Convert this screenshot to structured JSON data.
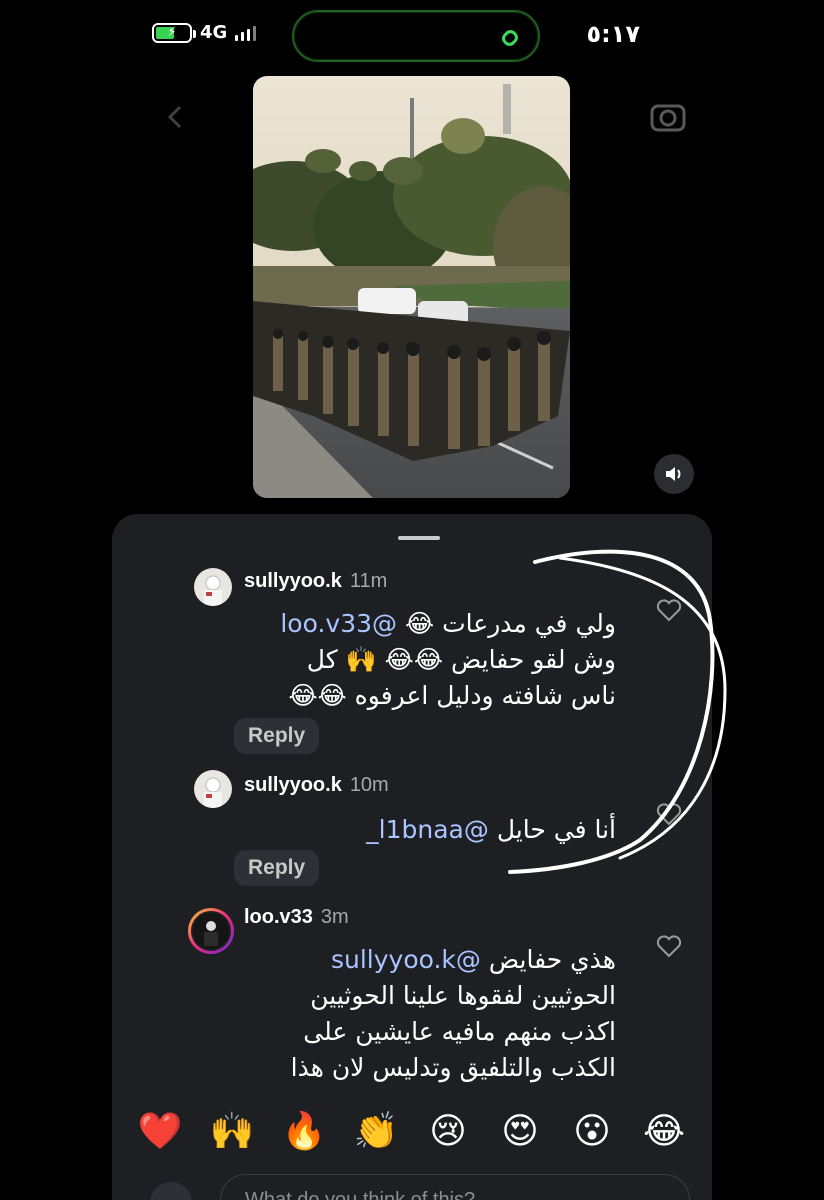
{
  "status_bar": {
    "time": "٥:١٧",
    "network": "4G",
    "battery_color": "#39d353"
  },
  "video": {
    "volume_icon": "speaker-icon"
  },
  "comments": [
    {
      "username": "sullyyoo.k",
      "time": "11m",
      "text_line1": "ولي في مدرعات 😂 ",
      "mention": "@loo.v33",
      "text_rest_lines": [
        "وش لقو حفايض 😂😂 🙌 كل",
        "ناس شافته ودليل اعرفوه 😂😂"
      ],
      "reply_label": "Reply"
    },
    {
      "username": "sullyyoo.k",
      "time": "10m",
      "text_line1": "أنا في حايل ",
      "mention": "@l1bnaa_",
      "reply_label": "Reply"
    },
    {
      "username": "loo.v33",
      "time": "3m",
      "text_line1": "هذي حفايض ",
      "mention": "@sullyyoo.k",
      "text_rest_lines": [
        "الحوثيين لفقوها علينا الحوثيين",
        "اكذب منهم مافيه عايشين على",
        "الكذب والتلفيق وتدليس لان هذا"
      ]
    }
  ],
  "reactions": [
    "❤️",
    "🙌",
    "🔥",
    "👏",
    "😢",
    "😍",
    "😮",
    "😂"
  ],
  "input": {
    "placeholder": "What do you think of this?"
  },
  "colors": {
    "sheet_bg": "#1d1f23",
    "mention": "#a9c4ff",
    "pill_bg": "#2d3035"
  }
}
